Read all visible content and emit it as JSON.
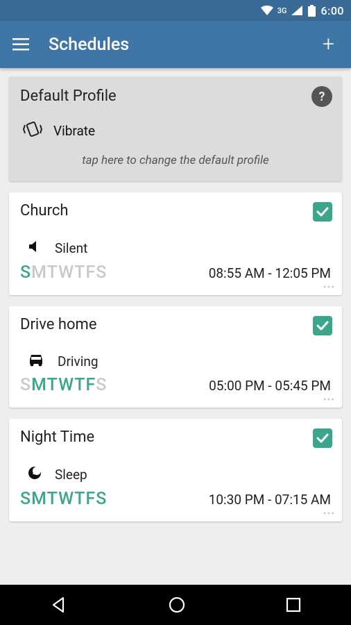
{
  "status": {
    "time": "6:00",
    "network": "3G"
  },
  "appbar": {
    "title": "Schedules"
  },
  "default": {
    "title": "Default Profile",
    "mode_label": "Vibrate",
    "hint": "tap here to change the default profile"
  },
  "schedules": [
    {
      "name": "Church",
      "mode_label": "Silent",
      "days_on": [
        0
      ],
      "time": "08:55 AM - 12:05 PM"
    },
    {
      "name": "Drive home",
      "mode_label": "Driving",
      "days_on": [
        1,
        2,
        3,
        4,
        5
      ],
      "time": "05:00 PM - 05:45 PM"
    },
    {
      "name": "Night Time",
      "mode_label": "Sleep",
      "days_on": [
        0,
        1,
        2,
        3,
        4,
        5,
        6
      ],
      "time": "10:30 PM - 07:15 AM"
    }
  ],
  "days_letters": [
    "S",
    "M",
    "T",
    "W",
    "T",
    "F",
    "S"
  ]
}
